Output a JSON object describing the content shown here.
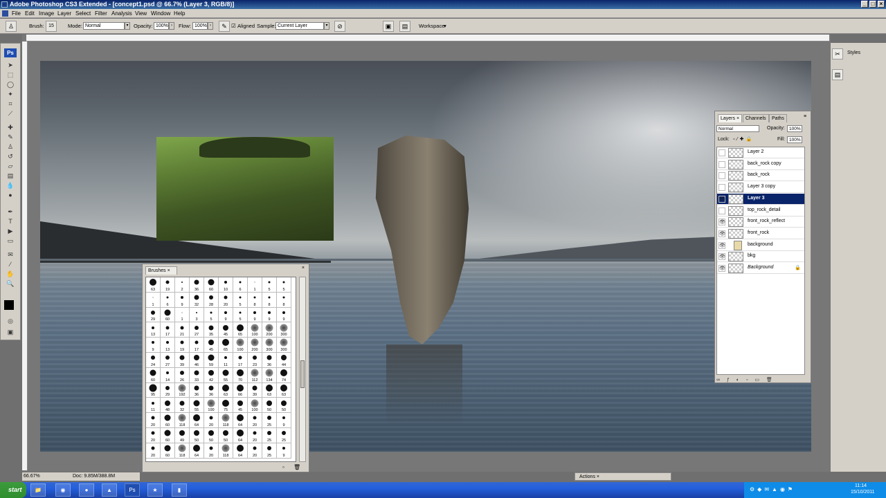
{
  "window": {
    "title": "Adobe Photoshop CS3 Extended - [concept1.psd @ 66.7% (Layer 3, RGB/8)]"
  },
  "menu": [
    "File",
    "Edit",
    "Image",
    "Layer",
    "Select",
    "Filter",
    "Analysis",
    "View",
    "Window",
    "Help"
  ],
  "options_bar": {
    "brush_label": "Brush:",
    "brush_size": "15",
    "mode_label": "Mode:",
    "mode_value": "Normal",
    "opacity_label": "Opacity:",
    "opacity_value": "100%",
    "flow_label": "Flow:",
    "flow_value": "100%",
    "aligned_label": "Aligned",
    "sample_label": "Sample:",
    "sample_value": "Current Layer",
    "workspace_label": "Workspace"
  },
  "tools_badge": "Ps",
  "brushes_panel": {
    "tab": "Brushes",
    "sizes": [
      "63",
      "19",
      "2",
      "36",
      "60",
      "10",
      "6",
      "1",
      "5",
      "5",
      "1",
      "6",
      "9",
      "32",
      "28",
      "20",
      "5",
      "8",
      "8",
      "8",
      "29",
      "60",
      "1",
      "3",
      "5",
      "9",
      "5",
      "9",
      "9",
      "9",
      "13",
      "17",
      "21",
      "27",
      "35",
      "45",
      "65",
      "100",
      "200",
      "300",
      "9",
      "13",
      "19",
      "17",
      "45",
      "65",
      "100",
      "200",
      "300",
      "300",
      "24",
      "27",
      "39",
      "46",
      "59",
      "11",
      "17",
      "23",
      "36",
      "44",
      "60",
      "14",
      "26",
      "33",
      "42",
      "55",
      "70",
      "112",
      "134",
      "74",
      "95",
      "29",
      "192",
      "36",
      "36",
      "63",
      "66",
      "39",
      "63",
      "63",
      "11",
      "48",
      "32",
      "55",
      "100",
      "75",
      "45",
      "100",
      "50",
      "50",
      "20",
      "60",
      "118",
      "64",
      "20",
      "118",
      "64",
      "20",
      "25",
      "9",
      "20",
      "60",
      "49",
      "50",
      "50",
      "50",
      "64",
      "20",
      "25",
      "25",
      "20",
      "60",
      "118",
      "64",
      "20",
      "118",
      "64",
      "20",
      "25",
      "9"
    ]
  },
  "layers_panel": {
    "tabs": [
      "Layers",
      "Channels",
      "Paths"
    ],
    "blend_mode": "Normal",
    "opacity_label": "Opacity:",
    "opacity_value": "100%",
    "lock_label": "Lock:",
    "fill_label": "Fill:",
    "fill_value": "100%",
    "layers": [
      {
        "name": "Layer 2",
        "visible": false,
        "selected": false
      },
      {
        "name": "back_rock copy",
        "visible": false,
        "selected": false
      },
      {
        "name": "back_rock",
        "visible": false,
        "selected": false
      },
      {
        "name": "Layer 3 copy",
        "visible": false,
        "selected": false
      },
      {
        "name": "Layer 3",
        "visible": true,
        "selected": true
      },
      {
        "name": "top_rock_detail",
        "visible": false,
        "selected": false
      },
      {
        "name": "front_rock_reflect",
        "visible": true,
        "selected": false
      },
      {
        "name": "front_rock",
        "visible": true,
        "selected": false
      },
      {
        "name": "background",
        "visible": true,
        "selected": false,
        "group": true
      },
      {
        "name": "bkg",
        "visible": true,
        "selected": false
      },
      {
        "name": "Background",
        "visible": true,
        "selected": false,
        "locked": true
      }
    ]
  },
  "right_strip": {
    "styles_label": "Styles"
  },
  "actions_panel": {
    "tab": "Actions"
  },
  "status": {
    "zoom": "66.67%",
    "doc": "Doc: 9.85M/388.8M"
  },
  "taskbar": {
    "start": "start",
    "time": "11:14",
    "date": "15/10/2011"
  }
}
